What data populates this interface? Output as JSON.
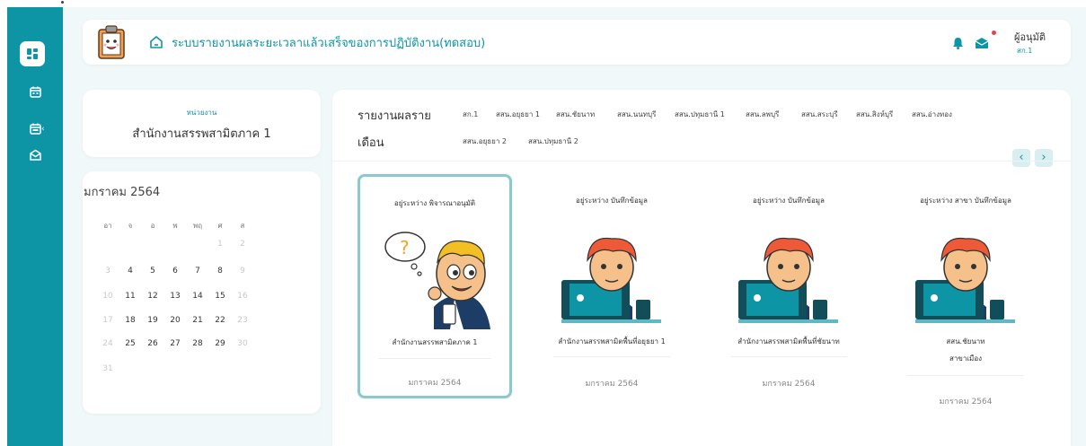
{
  "header": {
    "title": "ระบบรายงานผลระยะเวลาแล้วเสร็จของการปฏิบัติงาน(ทดสอบ)",
    "user_name": "ผู้อนุมัติ",
    "user_role": "สก.1"
  },
  "org": {
    "label": "หน่วยงาน",
    "name": "สำนักงานสรรพสามิตภาค 1"
  },
  "calendar": {
    "title": "มกราคม 2564",
    "weekdays": [
      "อา",
      "จ",
      "อ",
      "พ",
      "พฤ",
      "ศ",
      "ส"
    ],
    "weeks": [
      [
        "",
        "",
        "",
        "",
        "",
        "1",
        "2"
      ],
      [
        "3",
        "4",
        "5",
        "6",
        "7",
        "8",
        "9"
      ],
      [
        "10",
        "11",
        "12",
        "13",
        "14",
        "15",
        "16"
      ],
      [
        "17",
        "18",
        "19",
        "20",
        "21",
        "22",
        "23"
      ],
      [
        "24",
        "25",
        "26",
        "27",
        "28",
        "29",
        "30"
      ],
      [
        "31",
        "",
        "",
        "",
        "",
        "",
        ""
      ]
    ]
  },
  "report": {
    "title_line1": "รายงานผลราย",
    "title_line2": "เดือน",
    "filters_row1": [
      "สก.1",
      "สสน.อยุธยา 1",
      "สสน.ชัยนาท",
      "สสน.นนทบุรี",
      "สสน.ปทุมธานี 1",
      "สสน.ลพบุรี",
      "สสน.สระบุรี",
      "สสน.สิงห์บุรี",
      "สสน.อ่างทอง"
    ],
    "filters_row2": [
      "สสน.อยุธยา 2",
      "สสน.ปทุมธานี 2"
    ],
    "prev": "‹",
    "next": "›"
  },
  "tiles": [
    {
      "status": "อยู่ระหว่าง พิจารณาอนุมัติ",
      "org": "สำนักงานสรรพสามิตภาค 1",
      "org2": "",
      "date": "มกราคม 2564",
      "image": "thinking-man"
    },
    {
      "status": "อยู่ระหว่าง บันทึกข้อมูล",
      "org": "สำนักงานสรรพสามิตพื้นที่อยุธยา 1",
      "org2": "",
      "date": "มกราคม 2564",
      "image": "man-laptop"
    },
    {
      "status": "อยู่ระหว่าง บันทึกข้อมูล",
      "org": "สำนักงานสรรพสามิตพื้นที่ชัยนาท",
      "org2": "",
      "date": "มกราคม 2564",
      "image": "man-laptop"
    },
    {
      "status": "อยู่ระหว่าง สาขา บันทึกข้อมูล",
      "org": "สสน.ชัยนาท",
      "org2": "สาขาเมือง",
      "date": "มกราคม 2564",
      "image": "man-laptop"
    }
  ],
  "colors": {
    "accent": "#0d95a6",
    "background": "#f1f8f9",
    "notification": "#e8414c"
  }
}
